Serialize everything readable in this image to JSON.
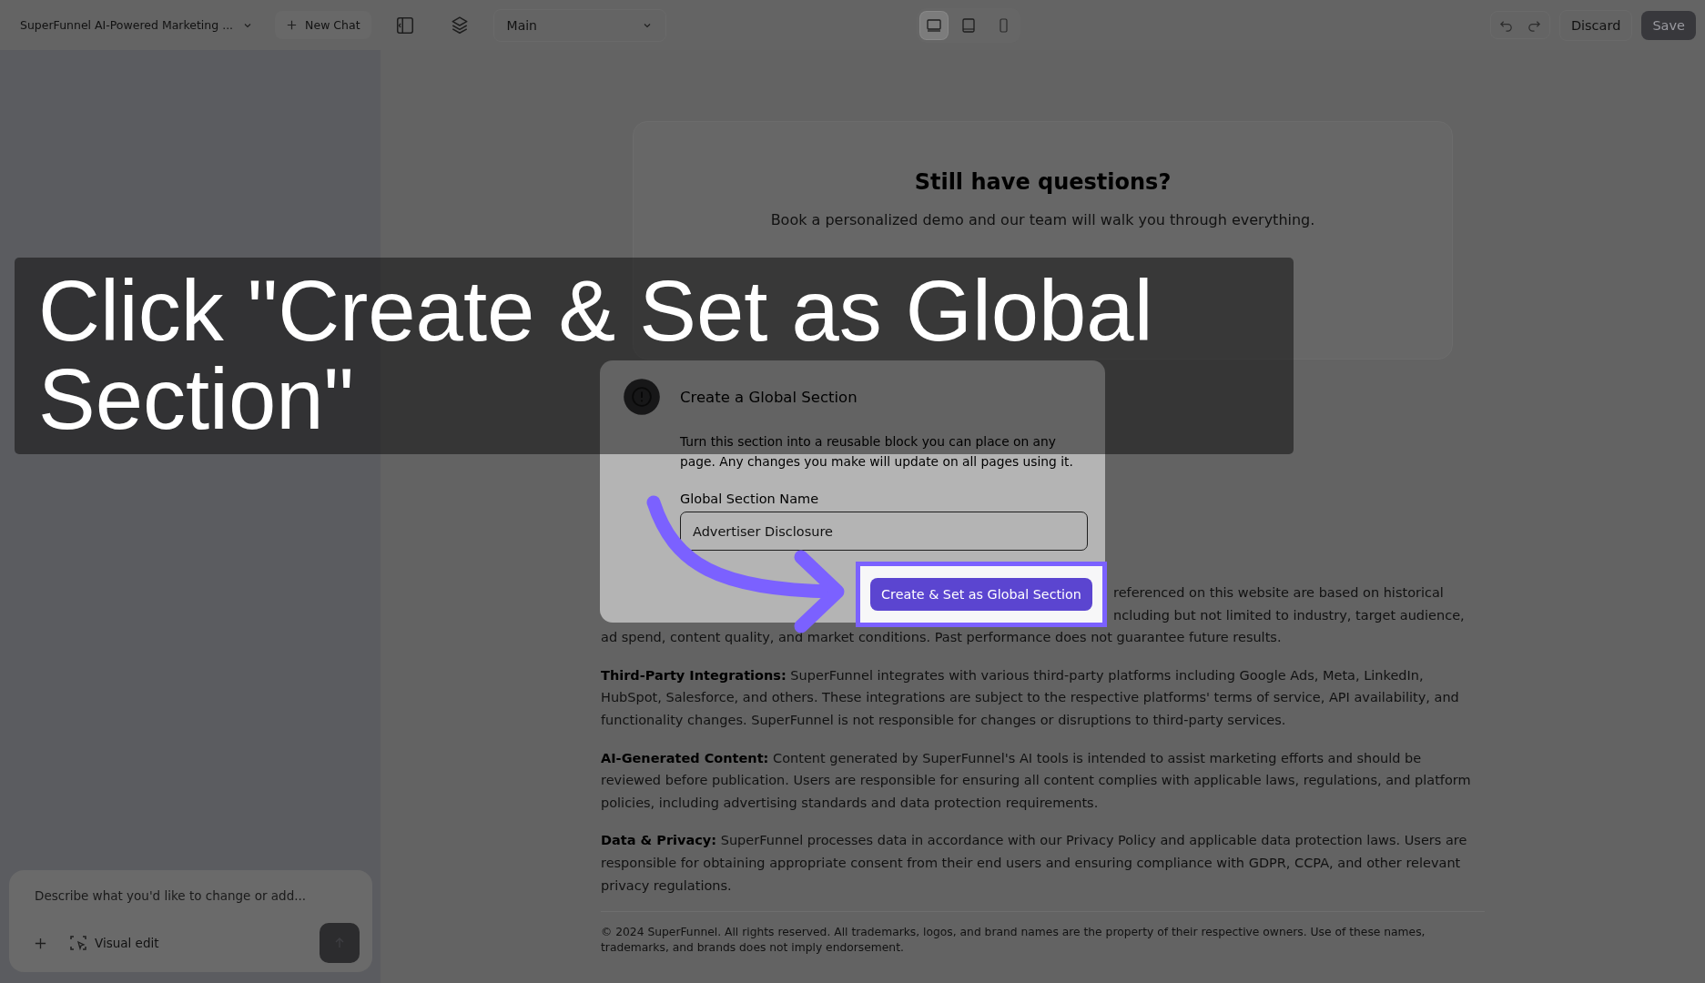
{
  "topbar": {
    "project": "SuperFunnel AI-Powered Marketing ...",
    "new_chat": "New Chat",
    "branch": "Main",
    "devices": [
      {
        "kind": "desktop",
        "selected": true
      },
      {
        "kind": "tablet",
        "selected": false
      },
      {
        "kind": "mobile",
        "selected": false
      }
    ],
    "discard": "Discard",
    "save": {
      "label": "Save",
      "disabled": true
    }
  },
  "chat": {
    "placeholder": "Describe what you'd like to change or add...",
    "visual_edit": "Visual edit"
  },
  "cta": {
    "title": "Still have questions?",
    "text": "Book a personalized demo and our team will walk you through everything."
  },
  "disclosure": {
    "partial_lines": [
      "referenced on this website are based on historical",
      "ncluding but not limited to industry, target audience,",
      "ad spend, content quality, and market conditions. Past performance does not guarantee future results."
    ],
    "paragraphs": [
      {
        "heading": "Third-Party Integrations:",
        "text": "SuperFunnel integrates with various third-party platforms including Google Ads, Meta, LinkedIn, HubSpot, Salesforce, and others. These integrations are subject to the respective platforms' terms of service, API availability, and functionality changes. SuperFunnel is not responsible for changes or disruptions to third-party services."
      },
      {
        "heading": "AI-Generated Content:",
        "text": "Content generated by SuperFunnel's AI tools is intended to assist marketing efforts and should be reviewed before publication. Users are responsible for ensuring all content complies with applicable laws, regulations, and platform policies, including advertising standards and data protection requirements."
      },
      {
        "heading": "Data & Privacy:",
        "text": "SuperFunnel processes data in accordance with our Privacy Policy and applicable data protection laws. Users are responsible for obtaining appropriate consent from their end users and ensuring compliance with GDPR, CCPA, and other relevant privacy regulations."
      }
    ],
    "footer": "© 2024 SuperFunnel. All rights reserved. All trademarks, logos, and brand names are the property of their respective owners. Use of these names, trademarks, and brands does not imply endorsement."
  },
  "dialog": {
    "title": "Create a Global Section",
    "description": "Turn this section into a reusable block you can place on any page. Any changes you make will update on all pages using it.",
    "field_label": "Global Section Name",
    "field_value": "Advertiser Disclosure",
    "button": "Create & Set as Global Section"
  },
  "tutorial": {
    "caption_lines": [
      "Click \"Create & Set as Global",
      "Section\""
    ]
  }
}
